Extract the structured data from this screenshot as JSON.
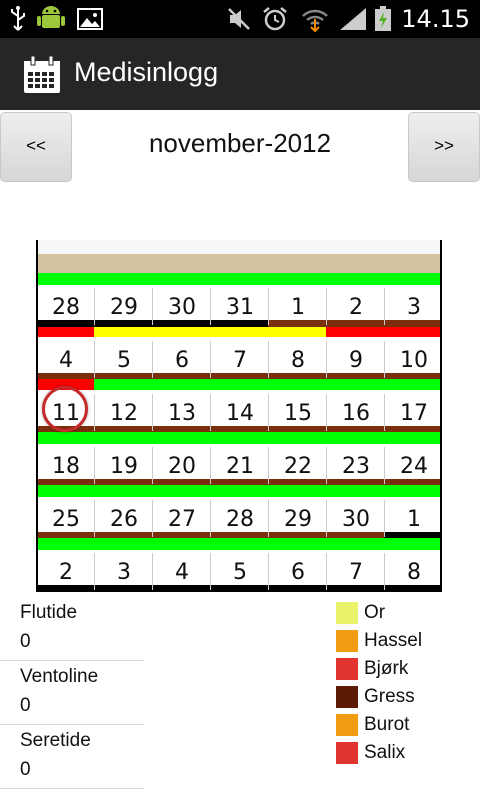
{
  "status_bar": {
    "time": "14.15",
    "icons": [
      "usb-icon",
      "android-icon",
      "image-icon",
      "mute-icon",
      "alarm-icon",
      "wifi-icon",
      "signal-icon",
      "battery-icon"
    ]
  },
  "app": {
    "title": "Medisinlogg",
    "icon": "calendar-icon"
  },
  "nav": {
    "prev_label": "<<",
    "next_label": ">>",
    "month": "november-2012"
  },
  "calendar": {
    "weeks": [
      [
        "28",
        "29",
        "30",
        "31",
        "1",
        "2",
        "3"
      ],
      [
        "4",
        "5",
        "6",
        "7",
        "8",
        "9",
        "10"
      ],
      [
        "11",
        "12",
        "13",
        "14",
        "15",
        "16",
        "17"
      ],
      [
        "18",
        "19",
        "20",
        "21",
        "22",
        "23",
        "24"
      ],
      [
        "25",
        "26",
        "27",
        "28",
        "29",
        "30",
        "1"
      ],
      [
        "2",
        "3",
        "4",
        "5",
        "6",
        "7",
        "8"
      ]
    ],
    "today": "11",
    "colors": {
      "green": "#00ff00",
      "brown": "#7a2e0e",
      "red": "#ff0000",
      "yellow": "#ffff00",
      "black": "#000000",
      "tan": "#d5c39f"
    }
  },
  "medications": [
    {
      "name": "Flutide",
      "value": "0"
    },
    {
      "name": "Ventoline",
      "value": "0"
    },
    {
      "name": "Seretide",
      "value": "0"
    }
  ],
  "legend": [
    {
      "label": "Or",
      "color": "#e9f36a"
    },
    {
      "label": "Hassel",
      "color": "#f29c12"
    },
    {
      "label": "Bjørk",
      "color": "#e0352f"
    },
    {
      "label": "Gress",
      "color": "#5c1b05"
    },
    {
      "label": "Burot",
      "color": "#f29c12"
    },
    {
      "label": "Salix",
      "color": "#e0352f"
    }
  ]
}
